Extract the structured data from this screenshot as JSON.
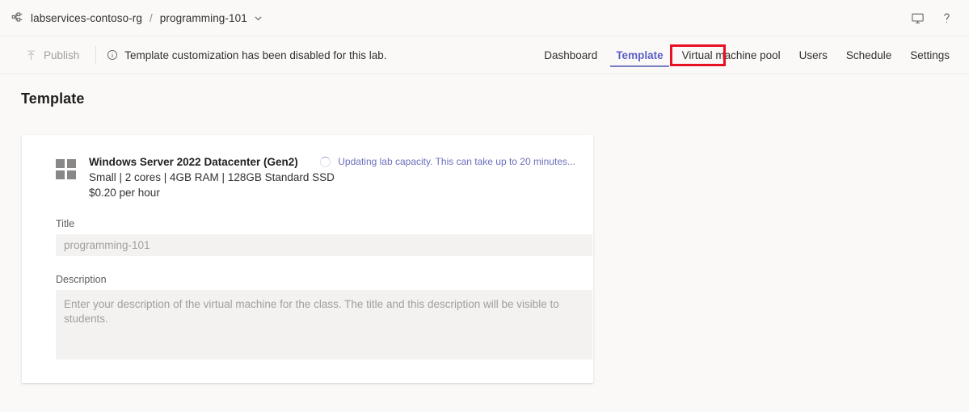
{
  "colors": {
    "accent": "#5b5fc7",
    "accent_underline": "#7b7fc4",
    "annotation": "#e81123",
    "page_bg": "#faf9f8",
    "card_bg": "#ffffff",
    "field_bg": "#f3f2f1",
    "status_text": "#6b6fbb"
  },
  "breadcrumb": {
    "resource_group_icon": "resource-group-icon",
    "resource_group": "labservices-contoso-rg",
    "separator": "/",
    "lab_name": "programming-101",
    "chevron_icon": "chevron-down-icon"
  },
  "topbar_actions": [
    {
      "icon": "monitor-icon",
      "name": "display-icon"
    },
    {
      "icon": "help-icon",
      "name": "help-question-icon"
    }
  ],
  "commandbar": {
    "publish": {
      "label": "Publish",
      "icon": "publish-upload-icon",
      "disabled": true
    },
    "message": {
      "icon": "info-circle-icon",
      "text": "Template customization has been disabled for this lab."
    }
  },
  "nav_tabs": [
    {
      "label": "Dashboard",
      "active": false
    },
    {
      "label": "Template",
      "active": true
    },
    {
      "label": "Virtual machine pool",
      "active": false
    },
    {
      "label": "Users",
      "active": false
    },
    {
      "label": "Schedule",
      "active": false
    },
    {
      "label": "Settings",
      "active": false
    }
  ],
  "page": {
    "title": "Template"
  },
  "template_card": {
    "vm": {
      "icon": "windows-logo-icon",
      "name": "Windows Server 2022 Datacenter (Gen2)",
      "spec": "Small | 2 cores | 4GB RAM | 128GB Standard SSD",
      "price": "$0.20 per hour"
    },
    "status": {
      "icon": "spinner-icon",
      "text": "Updating lab capacity. This can take up to 20 minutes..."
    },
    "title_field": {
      "label": "Title",
      "value": "programming-101",
      "placeholder": "programming-101"
    },
    "description_field": {
      "label": "Description",
      "value": "",
      "placeholder": "Enter your description of the virtual machine for the class. The title and this description will be visible to students."
    }
  }
}
